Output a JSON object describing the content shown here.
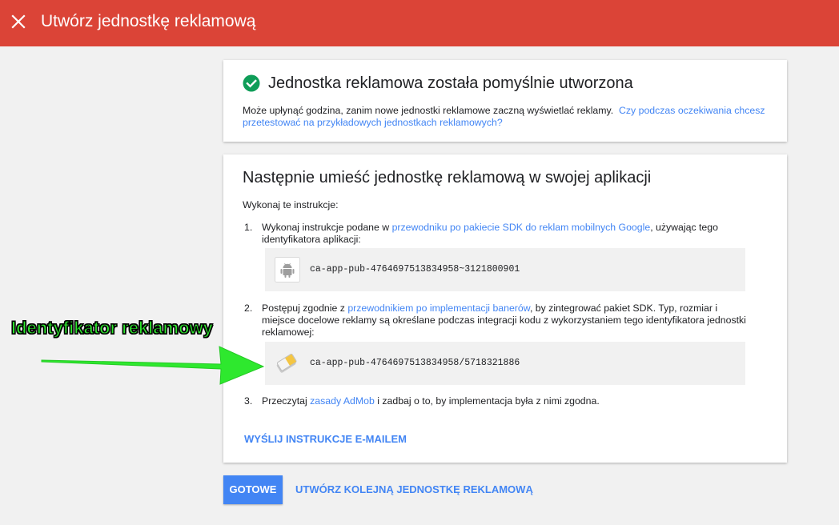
{
  "header": {
    "title": "Utwórz jednostkę reklamową",
    "close_icon": "close-icon",
    "background": "#db4437"
  },
  "success_card": {
    "icon": "check-circle-icon",
    "title": "Jednostka reklamowa została pomyślnie utworzona",
    "message": "Może upłynąć godzina, zanim nowe jednostki reklamowe zaczną wyświetlać reklamy.",
    "test_link": "Czy podczas oczekiwania chcesz przetestować na przykładowych jednostkach reklamowych?"
  },
  "placement_card": {
    "title": "Następnie umieść jednostkę reklamową w swojej aplikacji",
    "intro": "Wykonaj te instrukcje:",
    "steps": [
      {
        "number": "1.",
        "text_before": "Wykonaj instrukcje podane w ",
        "link": "przewodniku po pakiecie SDK do reklam mobilnych Google",
        "text_after": ", używając tego identyfikatora aplikacji:",
        "id_icon": "android-icon",
        "id_value": "ca-app-pub-4764697513834958~3121800901"
      },
      {
        "number": "2.",
        "text_before": "Postępuj zgodnie z ",
        "link": "przewodnikiem po implementacji banerów",
        "text_after": ", by zintegrować pakiet SDK. Typ, rozmiar i miejsce docelowe reklamy są określane podczas integracji kodu z wykorzystaniem tego identyfikatora jednostki reklamowej:",
        "id_icon": "banner-ad-icon",
        "id_value": "ca-app-pub-4764697513834958/5718321886"
      },
      {
        "number": "3.",
        "text_before": "Przeczytaj ",
        "link": "zasady AdMob",
        "text_after": " i zadbaj o to, by implementacja była z nimi zgodna."
      }
    ],
    "email_button": "WYŚLIJ INSTRUKCJE E-MAILEM"
  },
  "actions": {
    "done": "GOTOWE",
    "create_another": "UTWÓRZ KOLEJNĄ JEDNOSTKĘ REKLAMOWĄ"
  },
  "annotation": {
    "label": "Identyfikator reklamowy",
    "color": "#2ee82e"
  },
  "colors": {
    "accent": "#4285f4",
    "success": "#0f9d58"
  }
}
